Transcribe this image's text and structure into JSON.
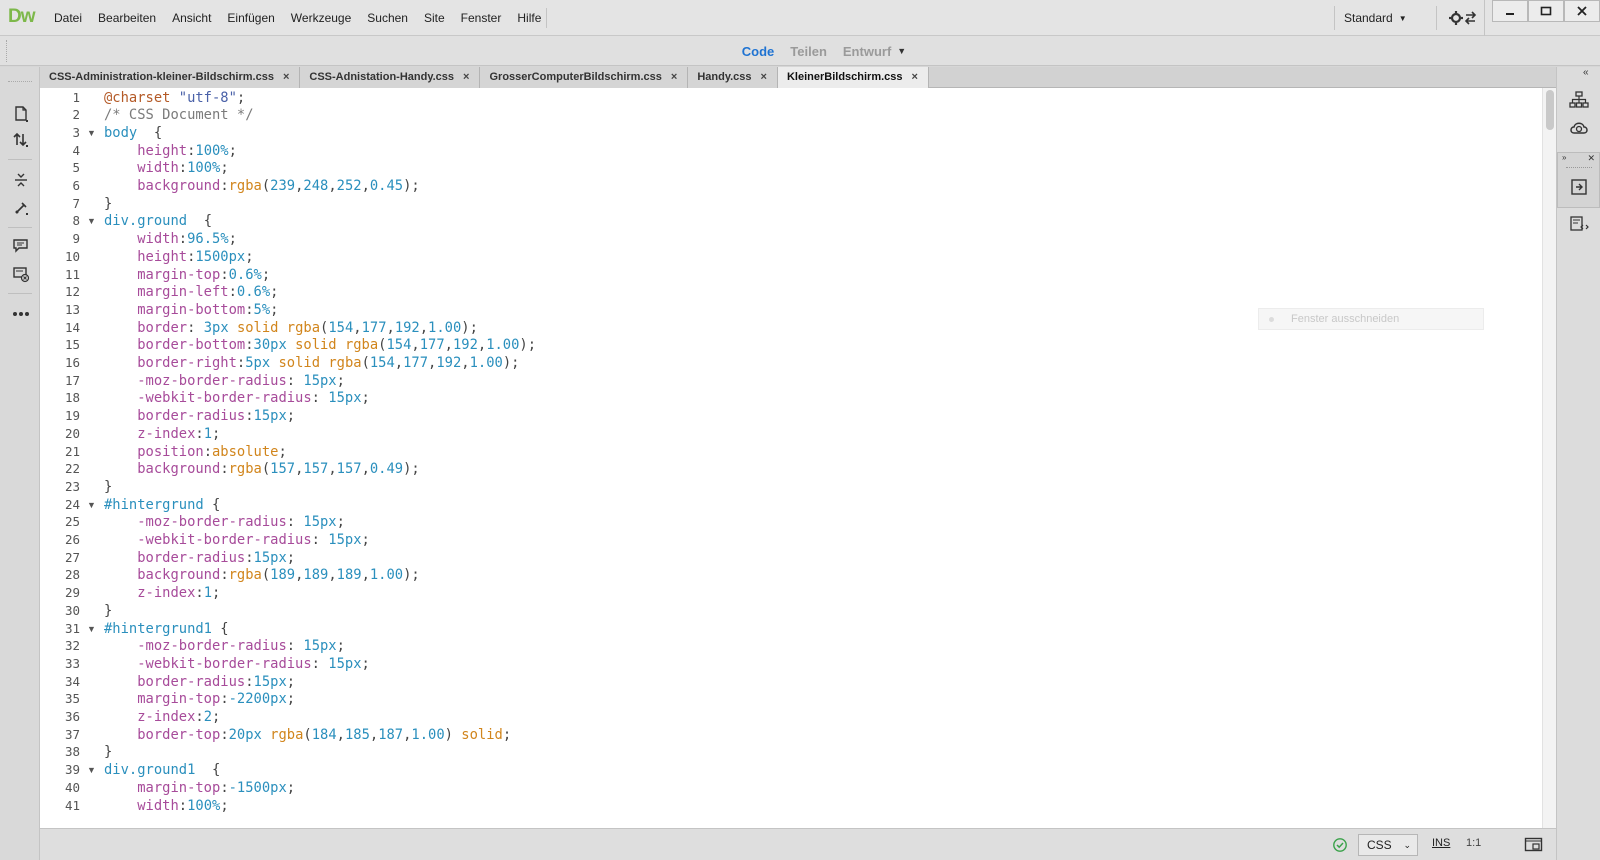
{
  "app": {
    "logo": "Dw"
  },
  "menubar": {
    "items": [
      "Datei",
      "Bearbeiten",
      "Ansicht",
      "Einfügen",
      "Werkzeuge",
      "Suchen",
      "Site",
      "Fenster",
      "Hilfe"
    ],
    "workspace": "Standard"
  },
  "viewbar": {
    "code": "Code",
    "split": "Teilen",
    "design": "Entwurf"
  },
  "tabs": [
    {
      "label": "CSS-Administration-kleiner-Bildschirm.css",
      "close": "×"
    },
    {
      "label": "CSS-Adnistation-Handy.css",
      "close": "×"
    },
    {
      "label": "GrosserComputerBildschirm.css",
      "close": "×"
    },
    {
      "label": "Handy.css",
      "close": "×"
    },
    {
      "label": "KleinerBildschirm.css",
      "close": "×"
    }
  ],
  "active_tab": 4,
  "editor": {
    "lines": [
      [
        [
          "at",
          "@charset "
        ],
        [
          "str",
          "\"utf-8\""
        ],
        [
          "p",
          ";"
        ]
      ],
      [
        [
          "com",
          "/* CSS Document */"
        ]
      ],
      [
        [
          "sel",
          "body"
        ],
        [
          "p",
          "  {"
        ]
      ],
      [
        [
          "p",
          "    "
        ],
        [
          "prop",
          "height"
        ],
        [
          "p",
          ":"
        ],
        [
          "num",
          "100%"
        ],
        [
          "p",
          ";"
        ]
      ],
      [
        [
          "p",
          "    "
        ],
        [
          "prop",
          "width"
        ],
        [
          "p",
          ":"
        ],
        [
          "num",
          "100%"
        ],
        [
          "p",
          ";"
        ]
      ],
      [
        [
          "p",
          "    "
        ],
        [
          "prop",
          "background"
        ],
        [
          "p",
          ":"
        ],
        [
          "kw",
          "rgba"
        ],
        [
          "p",
          "("
        ],
        [
          "num",
          "239"
        ],
        [
          "p",
          ","
        ],
        [
          "num",
          "248"
        ],
        [
          "p",
          ","
        ],
        [
          "num",
          "252"
        ],
        [
          "p",
          ","
        ],
        [
          "num",
          "0.45"
        ],
        [
          "p",
          ");"
        ]
      ],
      [
        [
          "p",
          "}"
        ]
      ],
      [
        [
          "sel",
          "div.ground"
        ],
        [
          "p",
          "  {"
        ]
      ],
      [
        [
          "p",
          "    "
        ],
        [
          "prop",
          "width"
        ],
        [
          "p",
          ":"
        ],
        [
          "num",
          "96.5%"
        ],
        [
          "p",
          ";"
        ]
      ],
      [
        [
          "p",
          "    "
        ],
        [
          "prop",
          "height"
        ],
        [
          "p",
          ":"
        ],
        [
          "num",
          "1500px"
        ],
        [
          "p",
          ";"
        ]
      ],
      [
        [
          "p",
          "    "
        ],
        [
          "prop",
          "margin-top"
        ],
        [
          "p",
          ":"
        ],
        [
          "num",
          "0.6%"
        ],
        [
          "p",
          ";"
        ]
      ],
      [
        [
          "p",
          "    "
        ],
        [
          "prop",
          "margin-left"
        ],
        [
          "p",
          ":"
        ],
        [
          "num",
          "0.6%"
        ],
        [
          "p",
          ";"
        ]
      ],
      [
        [
          "p",
          "    "
        ],
        [
          "prop",
          "margin-bottom"
        ],
        [
          "p",
          ":"
        ],
        [
          "num",
          "5%"
        ],
        [
          "p",
          ";"
        ]
      ],
      [
        [
          "p",
          "    "
        ],
        [
          "prop",
          "border"
        ],
        [
          "p",
          ": "
        ],
        [
          "num",
          "3px"
        ],
        [
          "p",
          " "
        ],
        [
          "kw",
          "solid"
        ],
        [
          "p",
          " "
        ],
        [
          "kw",
          "rgba"
        ],
        [
          "p",
          "("
        ],
        [
          "num",
          "154"
        ],
        [
          "p",
          ","
        ],
        [
          "num",
          "177"
        ],
        [
          "p",
          ","
        ],
        [
          "num",
          "192"
        ],
        [
          "p",
          ","
        ],
        [
          "num",
          "1.00"
        ],
        [
          "p",
          ");"
        ]
      ],
      [
        [
          "p",
          "    "
        ],
        [
          "prop",
          "border-bottom"
        ],
        [
          "p",
          ":"
        ],
        [
          "num",
          "30px"
        ],
        [
          "p",
          " "
        ],
        [
          "kw",
          "solid"
        ],
        [
          "p",
          " "
        ],
        [
          "kw",
          "rgba"
        ],
        [
          "p",
          "("
        ],
        [
          "num",
          "154"
        ],
        [
          "p",
          ","
        ],
        [
          "num",
          "177"
        ],
        [
          "p",
          ","
        ],
        [
          "num",
          "192"
        ],
        [
          "p",
          ","
        ],
        [
          "num",
          "1.00"
        ],
        [
          "p",
          ");"
        ]
      ],
      [
        [
          "p",
          "    "
        ],
        [
          "prop",
          "border-right"
        ],
        [
          "p",
          ":"
        ],
        [
          "num",
          "5px"
        ],
        [
          "p",
          " "
        ],
        [
          "kw",
          "solid"
        ],
        [
          "p",
          " "
        ],
        [
          "kw",
          "rgba"
        ],
        [
          "p",
          "("
        ],
        [
          "num",
          "154"
        ],
        [
          "p",
          ","
        ],
        [
          "num",
          "177"
        ],
        [
          "p",
          ","
        ],
        [
          "num",
          "192"
        ],
        [
          "p",
          ","
        ],
        [
          "num",
          "1.00"
        ],
        [
          "p",
          ");"
        ]
      ],
      [
        [
          "p",
          "    "
        ],
        [
          "prop",
          "-moz-border-radius"
        ],
        [
          "p",
          ": "
        ],
        [
          "num",
          "15px"
        ],
        [
          "p",
          ";"
        ]
      ],
      [
        [
          "p",
          "    "
        ],
        [
          "prop",
          "-webkit-border-radius"
        ],
        [
          "p",
          ": "
        ],
        [
          "num",
          "15px"
        ],
        [
          "p",
          ";"
        ]
      ],
      [
        [
          "p",
          "    "
        ],
        [
          "prop",
          "border-radius"
        ],
        [
          "p",
          ":"
        ],
        [
          "num",
          "15px"
        ],
        [
          "p",
          ";"
        ]
      ],
      [
        [
          "p",
          "    "
        ],
        [
          "prop",
          "z-index"
        ],
        [
          "p",
          ":"
        ],
        [
          "num",
          "1"
        ],
        [
          "p",
          ";"
        ]
      ],
      [
        [
          "p",
          "    "
        ],
        [
          "prop",
          "position"
        ],
        [
          "p",
          ":"
        ],
        [
          "kw",
          "absolute"
        ],
        [
          "p",
          ";"
        ]
      ],
      [
        [
          "p",
          "    "
        ],
        [
          "prop",
          "background"
        ],
        [
          "p",
          ":"
        ],
        [
          "kw",
          "rgba"
        ],
        [
          "p",
          "("
        ],
        [
          "num",
          "157"
        ],
        [
          "p",
          ","
        ],
        [
          "num",
          "157"
        ],
        [
          "p",
          ","
        ],
        [
          "num",
          "157"
        ],
        [
          "p",
          ","
        ],
        [
          "num",
          "0.49"
        ],
        [
          "p",
          ");"
        ]
      ],
      [
        [
          "p",
          "}"
        ]
      ],
      [
        [
          "sel",
          "#hintergrund"
        ],
        [
          "p",
          " {"
        ]
      ],
      [
        [
          "p",
          "    "
        ],
        [
          "prop",
          "-moz-border-radius"
        ],
        [
          "p",
          ": "
        ],
        [
          "num",
          "15px"
        ],
        [
          "p",
          ";"
        ]
      ],
      [
        [
          "p",
          "    "
        ],
        [
          "prop",
          "-webkit-border-radius"
        ],
        [
          "p",
          ": "
        ],
        [
          "num",
          "15px"
        ],
        [
          "p",
          ";"
        ]
      ],
      [
        [
          "p",
          "    "
        ],
        [
          "prop",
          "border-radius"
        ],
        [
          "p",
          ":"
        ],
        [
          "num",
          "15px"
        ],
        [
          "p",
          ";"
        ]
      ],
      [
        [
          "p",
          "    "
        ],
        [
          "prop",
          "background"
        ],
        [
          "p",
          ":"
        ],
        [
          "kw",
          "rgba"
        ],
        [
          "p",
          "("
        ],
        [
          "num",
          "189"
        ],
        [
          "p",
          ","
        ],
        [
          "num",
          "189"
        ],
        [
          "p",
          ","
        ],
        [
          "num",
          "189"
        ],
        [
          "p",
          ","
        ],
        [
          "num",
          "1.00"
        ],
        [
          "p",
          ");"
        ]
      ],
      [
        [
          "p",
          "    "
        ],
        [
          "prop",
          "z-index"
        ],
        [
          "p",
          ":"
        ],
        [
          "num",
          "1"
        ],
        [
          "p",
          ";"
        ]
      ],
      [
        [
          "p",
          "}"
        ]
      ],
      [
        [
          "sel",
          "#hintergrund1"
        ],
        [
          "p",
          " {"
        ]
      ],
      [
        [
          "p",
          "    "
        ],
        [
          "prop",
          "-moz-border-radius"
        ],
        [
          "p",
          ": "
        ],
        [
          "num",
          "15px"
        ],
        [
          "p",
          ";"
        ]
      ],
      [
        [
          "p",
          "    "
        ],
        [
          "prop",
          "-webkit-border-radius"
        ],
        [
          "p",
          ": "
        ],
        [
          "num",
          "15px"
        ],
        [
          "p",
          ";"
        ]
      ],
      [
        [
          "p",
          "    "
        ],
        [
          "prop",
          "border-radius"
        ],
        [
          "p",
          ":"
        ],
        [
          "num",
          "15px"
        ],
        [
          "p",
          ";"
        ]
      ],
      [
        [
          "p",
          "    "
        ],
        [
          "prop",
          "margin-top"
        ],
        [
          "p",
          ":"
        ],
        [
          "num",
          "-2200px"
        ],
        [
          "p",
          ";"
        ]
      ],
      [
        [
          "p",
          "    "
        ],
        [
          "prop",
          "z-index"
        ],
        [
          "p",
          ":"
        ],
        [
          "num",
          "2"
        ],
        [
          "p",
          ";"
        ]
      ],
      [
        [
          "p",
          "    "
        ],
        [
          "prop",
          "border-top"
        ],
        [
          "p",
          ":"
        ],
        [
          "num",
          "20px"
        ],
        [
          "p",
          " "
        ],
        [
          "kw",
          "rgba"
        ],
        [
          "p",
          "("
        ],
        [
          "num",
          "184"
        ],
        [
          "p",
          ","
        ],
        [
          "num",
          "185"
        ],
        [
          "p",
          ","
        ],
        [
          "num",
          "187"
        ],
        [
          "p",
          ","
        ],
        [
          "num",
          "1.00"
        ],
        [
          "p",
          ") "
        ],
        [
          "kw",
          "solid"
        ],
        [
          "p",
          ";"
        ]
      ],
      [
        [
          "p",
          "}"
        ]
      ],
      [
        [
          "sel",
          "div.ground1"
        ],
        [
          "p",
          "  {"
        ]
      ],
      [
        [
          "p",
          "    "
        ],
        [
          "prop",
          "margin-top"
        ],
        [
          "p",
          ":"
        ],
        [
          "num",
          "-1500px"
        ],
        [
          "p",
          ";"
        ]
      ],
      [
        [
          "p",
          "    "
        ],
        [
          "prop",
          "width"
        ],
        [
          "p",
          ":"
        ],
        [
          "num",
          "100%"
        ],
        [
          "p",
          ";"
        ]
      ]
    ],
    "fold_lines": [
      3,
      8,
      24,
      31,
      39
    ],
    "ghost_tooltip": "Fenster ausschneiden"
  },
  "statusbar": {
    "language": "CSS",
    "insert_mode": "INS",
    "cursor": "1:1"
  },
  "colors": {
    "selector": "#2a8fbd",
    "property": "#a74b9a",
    "keyword": "#d1851c",
    "string": "#4a61a8",
    "comment": "#7b7b7b",
    "accent": "#1f73d2",
    "logo": "#7db84a"
  }
}
